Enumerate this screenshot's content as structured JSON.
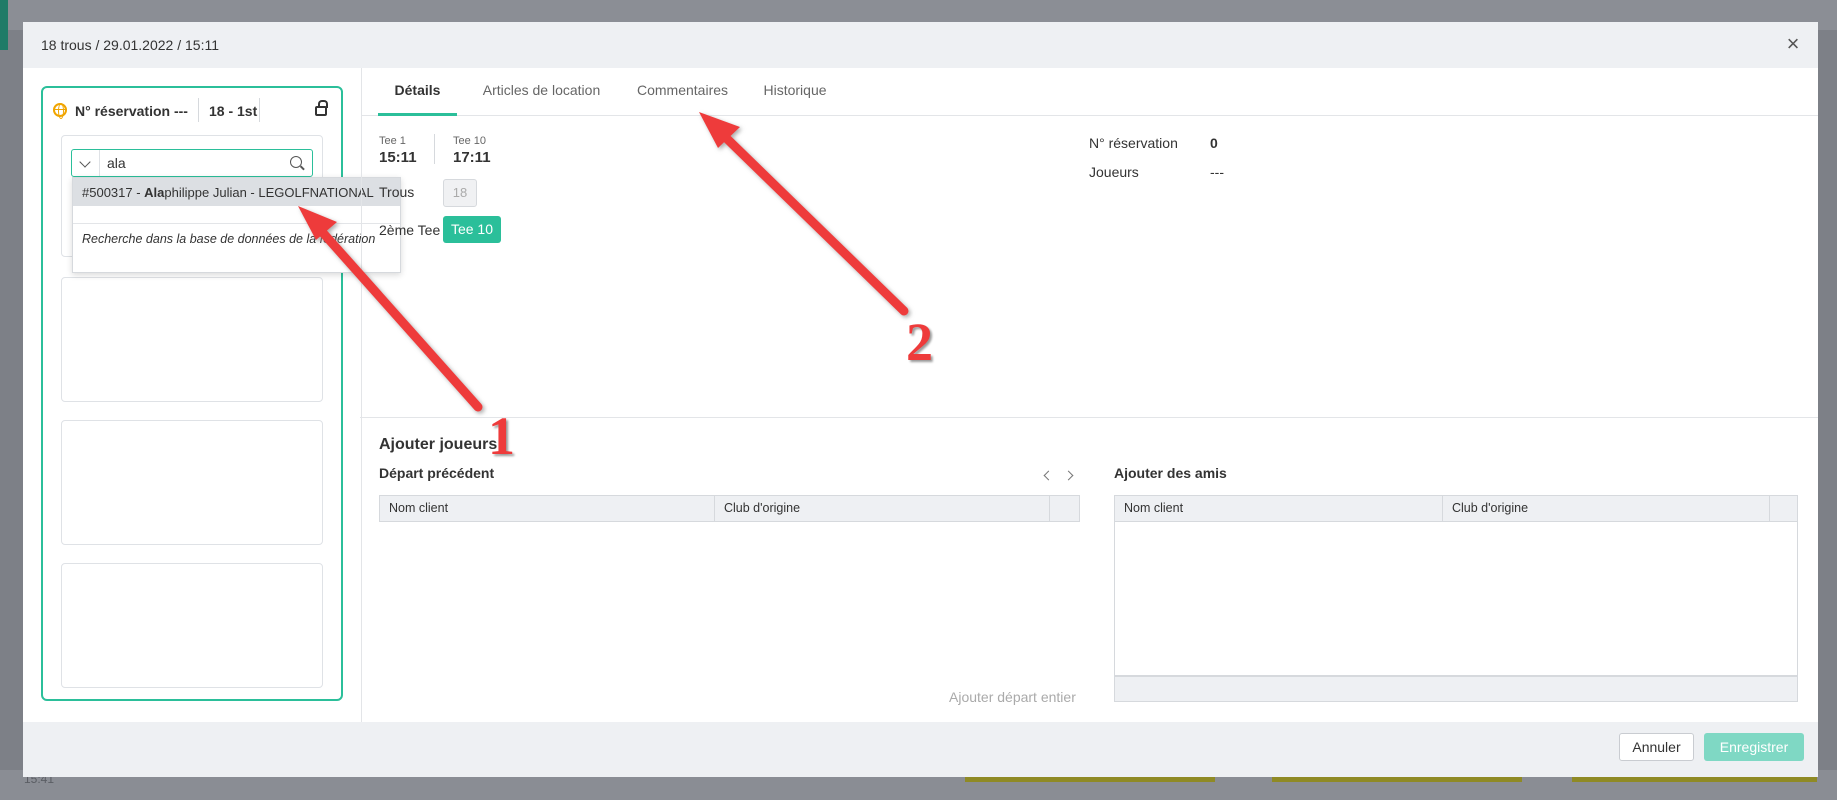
{
  "background": {
    "time": "15:41"
  },
  "modal": {
    "title": "18 trous / 29.01.2022 / 15:11",
    "close_label": "×",
    "footer": {
      "cancel": "Annuler",
      "save": "Enregistrer"
    }
  },
  "booking": {
    "icon": "globe-icon",
    "reservation_label": "N° réservation ---",
    "holes_badge": "18 - 1st",
    "lock_icon": "unlock-icon",
    "search": {
      "value": "ala",
      "placeholder": ""
    },
    "dropdown": {
      "result_prefix": "#500317 - ",
      "result_match": "Ala",
      "result_suffix": "philippe Julian - LEGOLFNATIONAL",
      "federation_search": "Recherche dans la base de données de la fédération"
    }
  },
  "tabs": [
    {
      "label": "Détails",
      "active": true
    },
    {
      "label": "Articles de location",
      "active": false
    },
    {
      "label": "Commentaires",
      "active": false
    },
    {
      "label": "Historique",
      "active": false
    }
  ],
  "details": {
    "tee1": {
      "label": "Tee 1",
      "time": "15:11"
    },
    "tee10": {
      "label": "Tee 10",
      "time": "17:11"
    },
    "holes_label": "Trous",
    "holes_value": "18",
    "second_tee_label": "2ème Tee",
    "second_tee_value": "Tee 10",
    "reservation_label": "N° réservation",
    "reservation_value": "0",
    "players_label": "Joueurs",
    "players_value": "---"
  },
  "add_players": {
    "title": "Ajouter joueurs",
    "previous_departure": {
      "title": "Départ précédent",
      "columns": [
        "Nom client",
        "Club d'origine"
      ],
      "rows": [],
      "add_all": "Ajouter départ entier"
    },
    "friends": {
      "title": "Ajouter des amis",
      "columns": [
        "Nom client",
        "Club d'origine"
      ],
      "rows": []
    }
  },
  "annotations": {
    "label1": "1",
    "label2": "2",
    "arrow_color": "#ee3b3b"
  },
  "colors": {
    "accent": "#2bbf9a",
    "save_disabled": "#7fd8c4",
    "globe": "#f0a500"
  }
}
